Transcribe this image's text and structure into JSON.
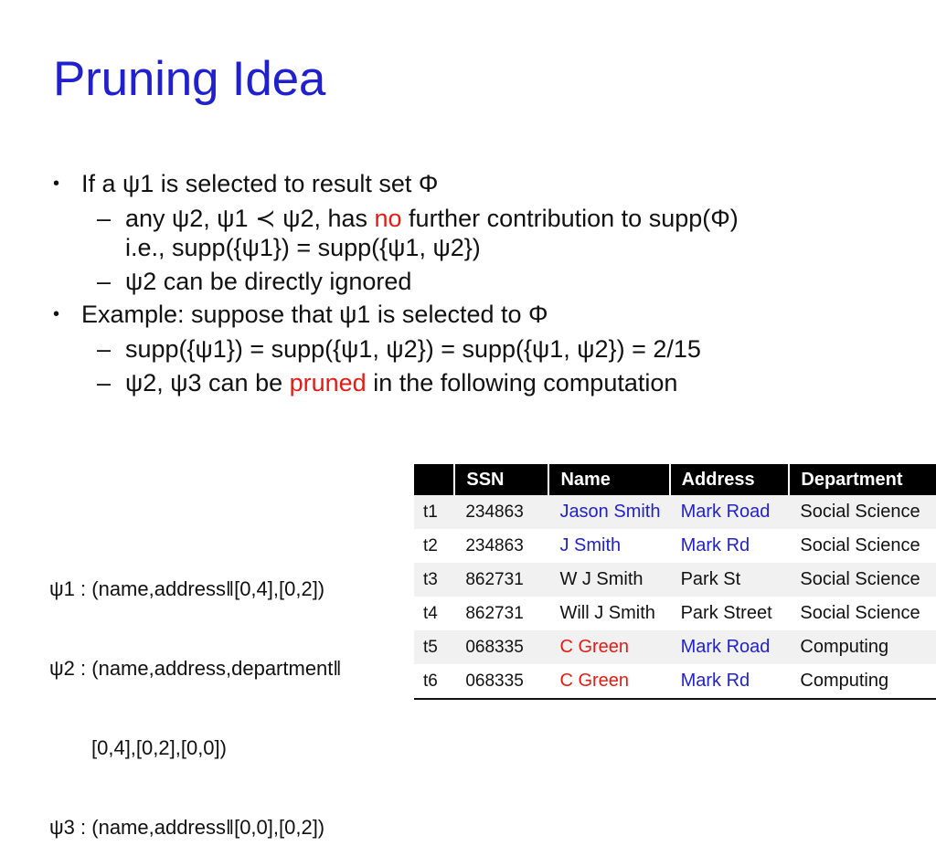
{
  "slide": {
    "title": "Pruning Idea",
    "title_color": "#2020D0",
    "accent_red": "#E41B14",
    "accent_blue": "#2222CC"
  },
  "bullets": [
    {
      "level": 1,
      "marker": "•",
      "parts": [
        {
          "text": "If a ψ1 is selected to result set Φ",
          "color": "black"
        }
      ]
    },
    {
      "level": 2,
      "marker": "–",
      "parts": [
        {
          "text": "any ψ2, ψ1 ≺ ψ2, has ",
          "color": "black"
        },
        {
          "text": "no",
          "color": "red"
        },
        {
          "text": " further contribution to supp(Φ)",
          "color": "black"
        }
      ],
      "continuation": "i.e., supp({ψ1}) = supp({ψ1, ψ2})"
    },
    {
      "level": 2,
      "marker": "–",
      "parts": [
        {
          "text": "ψ2 can be directly ignored",
          "color": "black"
        }
      ]
    },
    {
      "level": 1,
      "marker": "•",
      "parts": [
        {
          "text": "Example: suppose that ψ1 is selected to Φ",
          "color": "black"
        }
      ]
    },
    {
      "level": 2,
      "marker": "–",
      "parts": [
        {
          "text": "supp({ψ1}) = supp({ψ1, ψ2}) = supp({ψ1, ψ2}) = 2/15",
          "color": "black"
        }
      ]
    },
    {
      "level": 2,
      "marker": "–",
      "parts": [
        {
          "text": "ψ2, ψ3 can be ",
          "color": "black"
        },
        {
          "text": "pruned",
          "color": "red"
        },
        {
          "text": " in the following computation",
          "color": "black"
        }
      ]
    }
  ],
  "psi_definitions": {
    "line1": "ψ1 : (name,address‖[0,4],[0,2])",
    "line2": "ψ2 : (name,address,department‖",
    "line3": "[0,4],[0,2],[0,0])",
    "line4": "ψ3 : (name,address‖[0,0],[0,2])"
  },
  "table": {
    "headers": [
      "",
      "SSN",
      "Name",
      "Address",
      "Department"
    ],
    "rows": [
      {
        "id": "t1",
        "ssn": "234863",
        "name": "Jason Smith",
        "name_color": "blue",
        "address": "Mark Road",
        "address_color": "blue",
        "department": "Social Science",
        "department_color": "black",
        "shaded": true
      },
      {
        "id": "t2",
        "ssn": "234863",
        "name": "J Smith",
        "name_color": "blue",
        "address": "Mark Rd",
        "address_color": "blue",
        "department": "Social Science",
        "department_color": "black",
        "shaded": false
      },
      {
        "id": "t3",
        "ssn": "862731",
        "name": "W J Smith",
        "name_color": "black",
        "address": "Park St",
        "address_color": "black",
        "department": "Social Science",
        "department_color": "black",
        "shaded": true
      },
      {
        "id": "t4",
        "ssn": "862731",
        "name": "Will J Smith",
        "name_color": "black",
        "address": "Park Street",
        "address_color": "black",
        "department": "Social Science",
        "department_color": "black",
        "shaded": false
      },
      {
        "id": "t5",
        "ssn": "068335",
        "name": "C Green",
        "name_color": "red",
        "address": "Mark Road",
        "address_color": "blue",
        "department": "Computing",
        "department_color": "black",
        "shaded": true
      },
      {
        "id": "t6",
        "ssn": "068335",
        "name": "C Green",
        "name_color": "red",
        "address": "Mark Rd",
        "address_color": "blue",
        "department": "Computing",
        "department_color": "black",
        "shaded": false
      }
    ]
  }
}
